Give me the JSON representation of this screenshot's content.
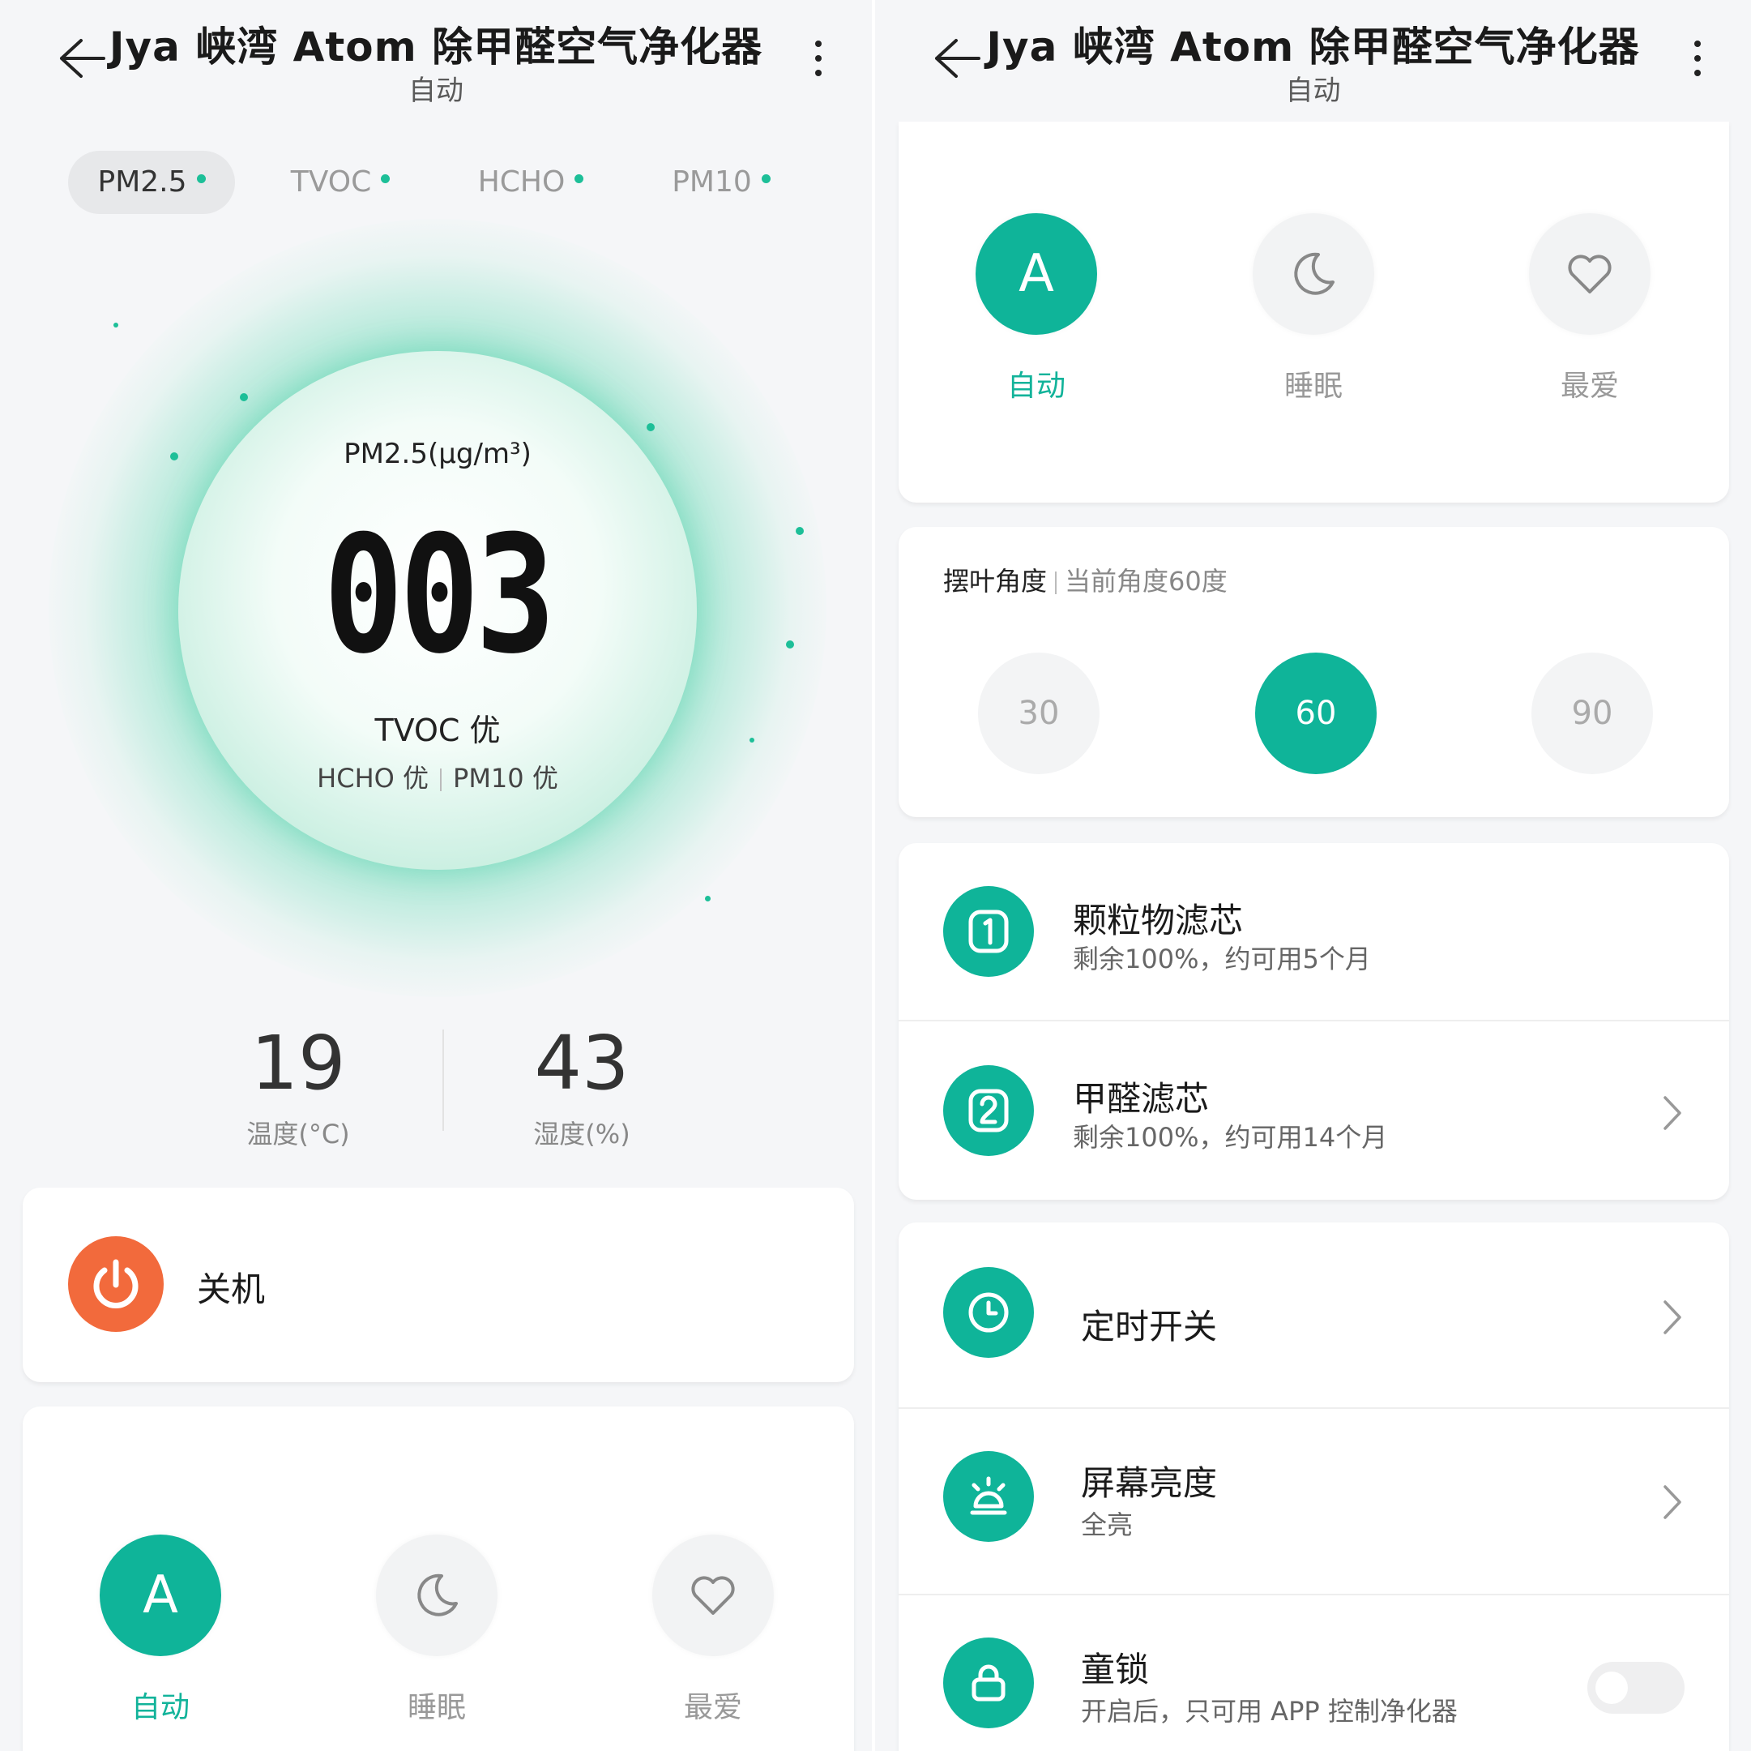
{
  "left": {
    "header": {
      "title": "Jya 峡湾 Atom 除甲醛空气净化器",
      "subtitle": "自动"
    },
    "tabs": [
      {
        "label": "PM2.5",
        "active": true
      },
      {
        "label": "TVOC",
        "active": false
      },
      {
        "label": "HCHO",
        "active": false
      },
      {
        "label": "PM10",
        "active": false
      }
    ],
    "gauge": {
      "label": "PM2.5(μg/m³)",
      "value": "003",
      "tvoc_text": "TVOC 优",
      "hcho_text": "HCHO 优",
      "pm10_text": "PM10 优"
    },
    "stats": {
      "temperature_value": "19",
      "temperature_label": "温度(°C)",
      "humidity_value": "43",
      "humidity_label": "湿度(%)"
    },
    "power": {
      "label": "关机"
    },
    "modes": [
      {
        "label": "自动",
        "icon": "A",
        "active": true
      },
      {
        "label": "睡眠",
        "icon": "moon-icon",
        "active": false
      },
      {
        "label": "最爱",
        "icon": "heart-icon",
        "active": false
      }
    ]
  },
  "right": {
    "header": {
      "title": "Jya 峡湾 Atom 除甲醛空气净化器",
      "subtitle": "自动"
    },
    "modes": [
      {
        "label": "自动",
        "icon": "A",
        "active": true
      },
      {
        "label": "睡眠",
        "icon": "moon-icon",
        "active": false
      },
      {
        "label": "最爱",
        "icon": "heart-icon",
        "active": false
      }
    ],
    "swing": {
      "title": "摆叶角度",
      "current": "当前角度60度",
      "options": [
        "30",
        "60",
        "90"
      ],
      "selected": "60"
    },
    "filters": [
      {
        "name": "颗粒物滤芯",
        "detail": "剩余100%，约可用5个月",
        "icon": "filter-1-icon"
      },
      {
        "name": "甲醛滤芯",
        "detail": "剩余100%，约可用14个月",
        "icon": "filter-2-icon"
      }
    ],
    "settings": {
      "timer": {
        "label": "定时开关"
      },
      "brightness": {
        "label": "屏幕亮度",
        "value": "全亮"
      },
      "child_lock": {
        "label": "童锁",
        "detail": "开启后，只可用 APP 控制净化器",
        "enabled": false
      }
    }
  },
  "colors": {
    "accent": "#0fb499",
    "power": "#f26a3c",
    "background": "#f5f6f8"
  }
}
